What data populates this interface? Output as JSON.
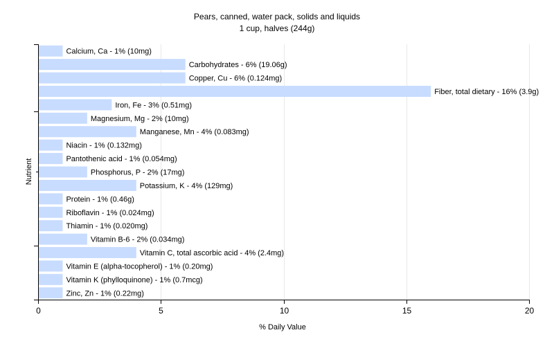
{
  "chart_data": {
    "type": "bar",
    "orientation": "horizontal",
    "title": "Pears, canned, water pack, solids and liquids",
    "subtitle": "1 cup, halves (244g)",
    "xlabel": "% Daily Value",
    "ylabel": "Nutrient",
    "xlim": [
      0,
      20
    ],
    "xticks": [
      "0",
      "5",
      "10",
      "15",
      "20"
    ],
    "grid": true,
    "bar_color": "#c8dcff",
    "grid_color": "#e8e8e8",
    "categories": [
      "Calcium, Ca",
      "Carbohydrates",
      "Copper, Cu",
      "Fiber, total dietary",
      "Iron, Fe",
      "Magnesium, Mg",
      "Manganese, Mn",
      "Niacin",
      "Pantothenic acid",
      "Phosphorus, P",
      "Potassium, K",
      "Protein",
      "Riboflavin",
      "Thiamin",
      "Vitamin B-6",
      "Vitamin C, total ascorbic acid",
      "Vitamin E (alpha-tocopherol)",
      "Vitamin K (phylloquinone)",
      "Zinc, Zn"
    ],
    "values": [
      1,
      6,
      6,
      16,
      3,
      2,
      4,
      1,
      1,
      2,
      4,
      1,
      1,
      1,
      2,
      4,
      1,
      1,
      1
    ],
    "labels": [
      "Calcium, Ca - 1% (10mg)",
      "Carbohydrates - 6% (19.06g)",
      "Copper, Cu - 6% (0.124mg)",
      "Fiber, total dietary - 16% (3.9g)",
      "Iron, Fe - 3% (0.51mg)",
      "Magnesium, Mg - 2% (10mg)",
      "Manganese, Mn - 4% (0.083mg)",
      "Niacin - 1% (0.132mg)",
      "Pantothenic acid - 1% (0.054mg)",
      "Phosphorus, P - 2% (17mg)",
      "Potassium, K - 4% (129mg)",
      "Protein - 1% (0.46g)",
      "Riboflavin - 1% (0.024mg)",
      "Thiamin - 1% (0.020mg)",
      "Vitamin B-6 - 2% (0.034mg)",
      "Vitamin C, total ascorbic acid - 4% (2.4mg)",
      "Vitamin E (alpha-tocopherol) - 1% (0.20mg)",
      "Vitamin K (phylloquinone) - 1% (0.7mcg)",
      "Zinc, Zn - 1% (0.22mg)"
    ]
  }
}
